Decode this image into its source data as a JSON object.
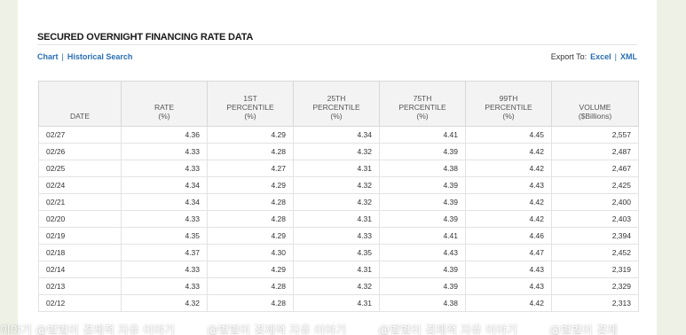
{
  "title": "SECURED OVERNIGHT FINANCING RATE DATA",
  "links": {
    "chart": "Chart",
    "separator": "|",
    "historical": "Historical Search"
  },
  "export": {
    "label": "Export To:",
    "excel": "Excel",
    "separator": "|",
    "xml": "XML"
  },
  "columns": [
    {
      "l1": "DATE",
      "l2": "",
      "l3": ""
    },
    {
      "l1": "RATE",
      "l2": "(%)",
      "l3": ""
    },
    {
      "l1": "1ST",
      "l2": "PERCENTILE",
      "l3": "(%)"
    },
    {
      "l1": "25TH",
      "l2": "PERCENTILE",
      "l3": "(%)"
    },
    {
      "l1": "75TH",
      "l2": "PERCENTILE",
      "l3": "(%)"
    },
    {
      "l1": "99TH",
      "l2": "PERCENTILE",
      "l3": "(%)"
    },
    {
      "l1": "VOLUME",
      "l2": "($Billions)",
      "l3": ""
    }
  ],
  "rows": [
    [
      "02/27",
      "4.36",
      "4.29",
      "4.34",
      "4.41",
      "4.45",
      "2,557"
    ],
    [
      "02/26",
      "4.33",
      "4.28",
      "4.32",
      "4.39",
      "4.42",
      "2,487"
    ],
    [
      "02/25",
      "4.33",
      "4.27",
      "4.31",
      "4.38",
      "4.42",
      "2,467"
    ],
    [
      "02/24",
      "4.34",
      "4.29",
      "4.32",
      "4.39",
      "4.43",
      "2,425"
    ],
    [
      "02/21",
      "4.34",
      "4.28",
      "4.32",
      "4.39",
      "4.42",
      "2,400"
    ],
    [
      "02/20",
      "4.33",
      "4.28",
      "4.31",
      "4.39",
      "4.42",
      "2,403"
    ],
    [
      "02/19",
      "4.35",
      "4.29",
      "4.33",
      "4.41",
      "4.46",
      "2,394"
    ],
    [
      "02/18",
      "4.37",
      "4.30",
      "4.35",
      "4.43",
      "4.47",
      "2,452"
    ],
    [
      "02/14",
      "4.33",
      "4.29",
      "4.31",
      "4.39",
      "4.43",
      "2,319"
    ],
    [
      "02/13",
      "4.33",
      "4.28",
      "4.32",
      "4.39",
      "4.43",
      "2,329"
    ],
    [
      "02/12",
      "4.32",
      "4.28",
      "4.31",
      "4.38",
      "4.42",
      "2,313"
    ]
  ],
  "watermark": [
    "이야기 @벌벌이 경제적 자유 이야기",
    "@벌벌이 경제적 자유 이야기",
    "@벌벌이 경제적 자유 이야기",
    "@벌벌이 경제"
  ]
}
